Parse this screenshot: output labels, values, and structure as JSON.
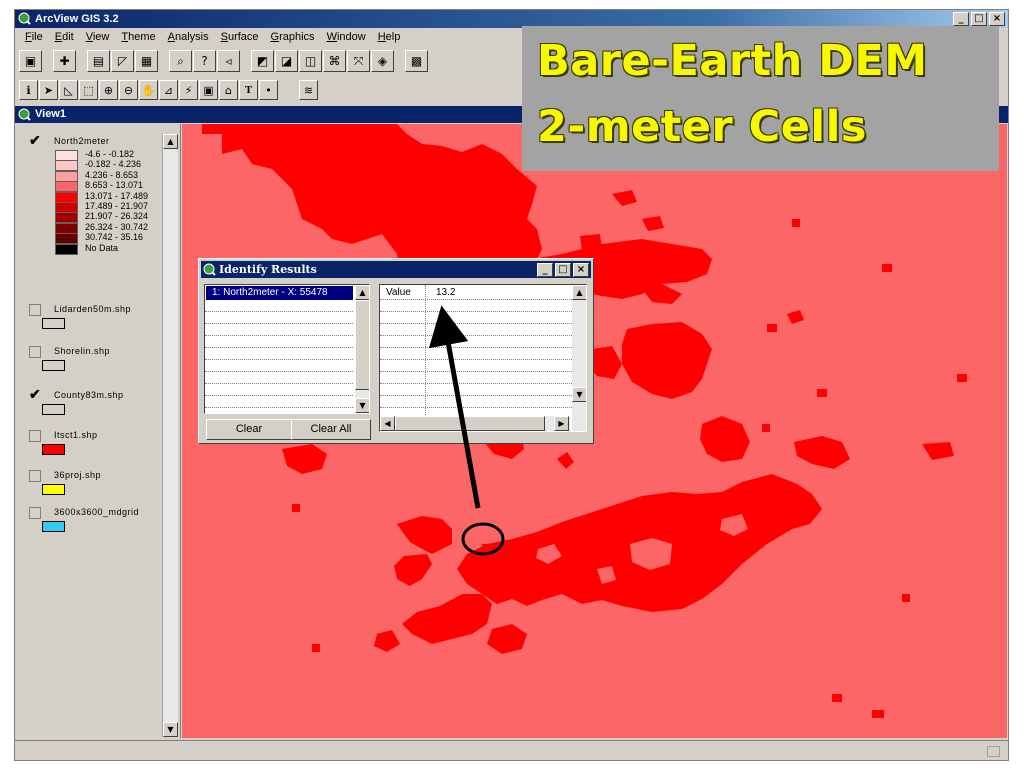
{
  "app": {
    "title": "ArcView GIS 3.2"
  },
  "menu": [
    {
      "label": "File",
      "key": "F",
      "rest": "ile"
    },
    {
      "label": "Edit",
      "key": "E",
      "rest": "dit"
    },
    {
      "label": "View",
      "key": "V",
      "rest": "iew"
    },
    {
      "label": "Theme",
      "key": "T",
      "rest": "heme"
    },
    {
      "label": "Analysis",
      "key": "A",
      "rest": "nalysis"
    },
    {
      "label": "Surface",
      "key": "S",
      "rest": "urface"
    },
    {
      "label": "Graphics",
      "key": "G",
      "rest": "raphics"
    },
    {
      "label": "Window",
      "key": "W",
      "rest": "indow"
    },
    {
      "label": "Help",
      "key": "H",
      "rest": "elp"
    }
  ],
  "view": {
    "title": "View1"
  },
  "toc": {
    "north2meter": {
      "name": "North2meter",
      "checked": true,
      "classes": [
        {
          "label": "-4.6 - -0.182",
          "color": "#ffe0e0"
        },
        {
          "label": "-0.182 - 4.236",
          "color": "#ffc4c4"
        },
        {
          "label": "4.236 - 8.653",
          "color": "#ffa0a0"
        },
        {
          "label": "8.653 - 13.071",
          "color": "#fd6666"
        },
        {
          "label": "13.071 - 17.489",
          "color": "#ff0000"
        },
        {
          "label": "17.489 - 21.907",
          "color": "#d00000"
        },
        {
          "label": "21.907 - 26.324",
          "color": "#a00000"
        },
        {
          "label": "26.324 - 30.742",
          "color": "#800000"
        },
        {
          "label": "30.742 - 35.16",
          "color": "#600000"
        },
        {
          "label": "No Data",
          "color": "#000000"
        }
      ]
    },
    "others": [
      {
        "name": "Lidarden50m.shp",
        "checked": false,
        "color": "#d4d0c8"
      },
      {
        "name": "Shorelin.shp",
        "checked": false,
        "color": "#d4d0c8"
      },
      {
        "name": "County83m.shp",
        "checked": true,
        "color": "#d4d0c8"
      },
      {
        "name": "Itsct1.shp",
        "checked": false,
        "color": "#ff0000"
      },
      {
        "name": "36proj.shp",
        "checked": false,
        "color": "#ffff00"
      },
      {
        "name": "3600x3600_mdgrid",
        "checked": false,
        "color": "#33ccee"
      }
    ]
  },
  "identify": {
    "title": "Identify Results",
    "selected_item": "1: North2meter - X: 55478",
    "field_name": "Value",
    "field_value": "13.2",
    "clear_label": "Clear",
    "clear_all_label": "Clear All"
  },
  "overlay": {
    "line1": "Bare-Earth DEM",
    "line2": "2-meter Cells"
  },
  "colors": {
    "map_base": "#fd6666",
    "map_high": "#ff0000",
    "overlay_text": "#f8f800",
    "overlay_bg": "#a3a3a3"
  }
}
